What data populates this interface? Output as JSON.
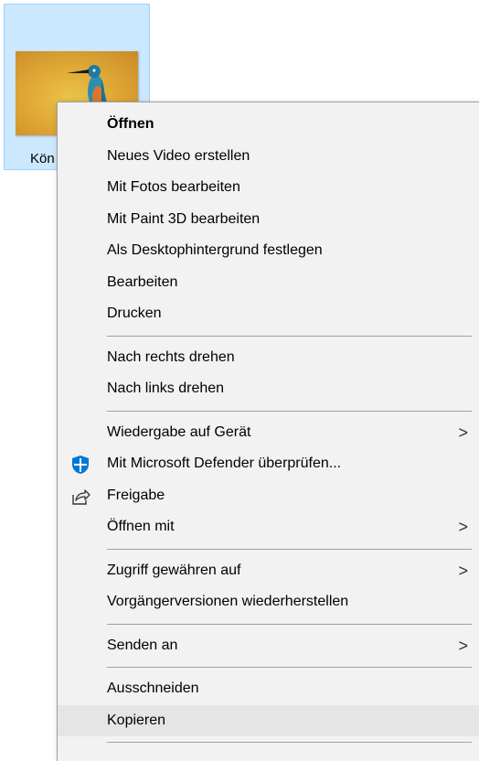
{
  "file": {
    "label": "Kön"
  },
  "menu": {
    "items": [
      {
        "label": "Öffnen",
        "bold": true
      },
      {
        "label": "Neues Video erstellen"
      },
      {
        "label": "Mit Fotos bearbeiten"
      },
      {
        "label": "Mit Paint 3D bearbeiten"
      },
      {
        "label": "Als Desktophintergrund festlegen"
      },
      {
        "label": "Bearbeiten"
      },
      {
        "label": "Drucken"
      },
      {
        "label": "Nach rechts drehen"
      },
      {
        "label": "Nach links drehen"
      },
      {
        "label": "Wiedergabe auf Gerät",
        "submenu": true
      },
      {
        "label": "Mit Microsoft Defender überprüfen...",
        "icon": "defender-shield-icon"
      },
      {
        "label": "Freigabe",
        "icon": "share-icon"
      },
      {
        "label": "Öffnen mit",
        "submenu": true
      },
      {
        "label": "Zugriff gewähren auf",
        "submenu": true
      },
      {
        "label": "Vorgängerversionen wiederherstellen"
      },
      {
        "label": "Senden an",
        "submenu": true
      },
      {
        "label": "Ausschneiden"
      },
      {
        "label": "Kopieren",
        "highlighted": true
      }
    ],
    "submenu_glyph": ">"
  },
  "colors": {
    "selection_bg": "#cce8ff",
    "menu_bg": "#f2f2f2",
    "defender_blue": "#0078d4"
  }
}
